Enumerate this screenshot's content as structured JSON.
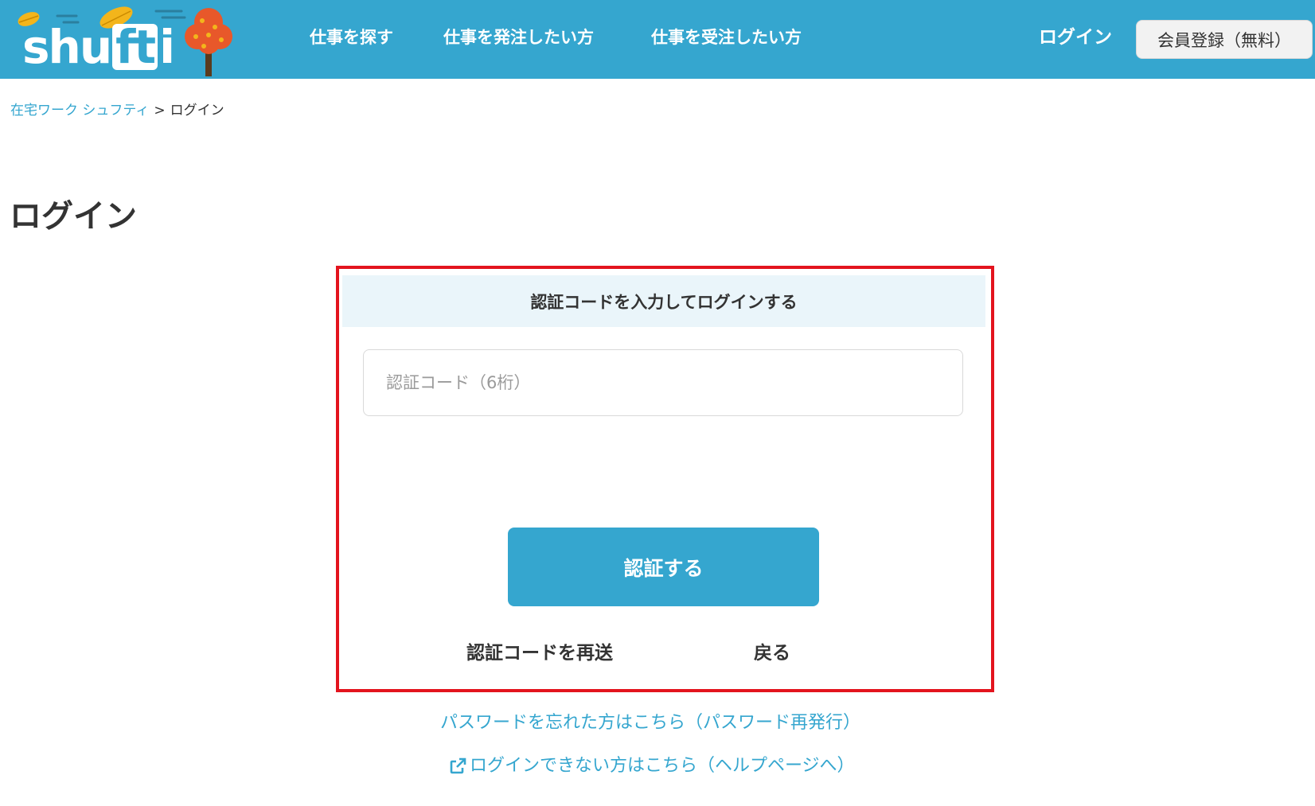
{
  "header": {
    "logo_text_1": "shu",
    "logo_text_2": "ft",
    "logo_text_3": "i",
    "nav": [
      {
        "label": "仕事を探す"
      },
      {
        "label": "仕事を発注したい方"
      },
      {
        "label": "仕事を受注したい方"
      }
    ],
    "login_label": "ログイン",
    "register_label": "会員登録（無料）"
  },
  "breadcrumb": {
    "home_label": "在宅ワーク シュフティ",
    "separator": ">",
    "current_label": "ログイン"
  },
  "page_title": "ログイン",
  "card": {
    "heading": "認証コードを入力してログインする",
    "input_placeholder": "認証コード（6桁）",
    "input_value": "",
    "submit_label": "認証する",
    "resend_label": "認証コードを再送",
    "back_label": "戻る"
  },
  "links": {
    "forgot_password": "パスワードを忘れた方はこちら（パスワード再発行）",
    "help_page": "ログインできない方はこちら（ヘルプページへ）"
  },
  "colors": {
    "brand": "#35a6cf",
    "highlight_border": "#e3141e",
    "card_head_bg": "#eaf5fa",
    "tree_orange": "#e8582a",
    "leaf_yellow": "#f3b51b"
  },
  "icons": {
    "logo": "shufti-logo",
    "tree": "autumn-tree-icon",
    "leaf": "leaf-icon",
    "external": "external-link-icon"
  }
}
